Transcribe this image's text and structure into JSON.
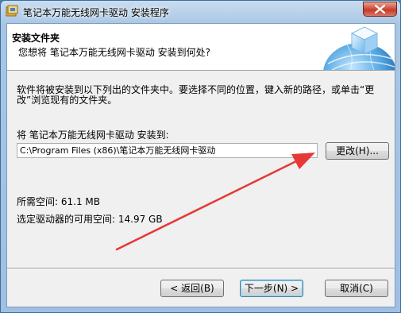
{
  "window": {
    "title": "笔记本万能无线网卡驱动 安装程序"
  },
  "header": {
    "title": "安装文件夹",
    "subtitle": "您想将 笔记本万能无线网卡驱动 安装到何处?"
  },
  "body": {
    "description": "软件将被安装到以下列出的文件夹中。要选择不同的位置，键入新的路径，或单击“更改”浏览现有的文件夹。",
    "destination_label": "将 笔记本万能无线网卡驱动 安装到:",
    "path_value": "C:\\Program Files (x86)\\笔记本万能无线网卡驱动",
    "change_button": "更改(H)...",
    "space_required": "所需空间: 61.1 MB",
    "space_available": "选定驱动器的可用空间: 14.97 GB"
  },
  "footer": {
    "back_button": "< 返回(B)",
    "next_button": "下一步(N) >",
    "cancel_button": "取消(C)"
  },
  "colors": {
    "annotation_arrow": "#e53935",
    "close_button": "#c43b26"
  },
  "icons": [
    "installer-icon",
    "close-icon",
    "globe-box-graphic"
  ]
}
